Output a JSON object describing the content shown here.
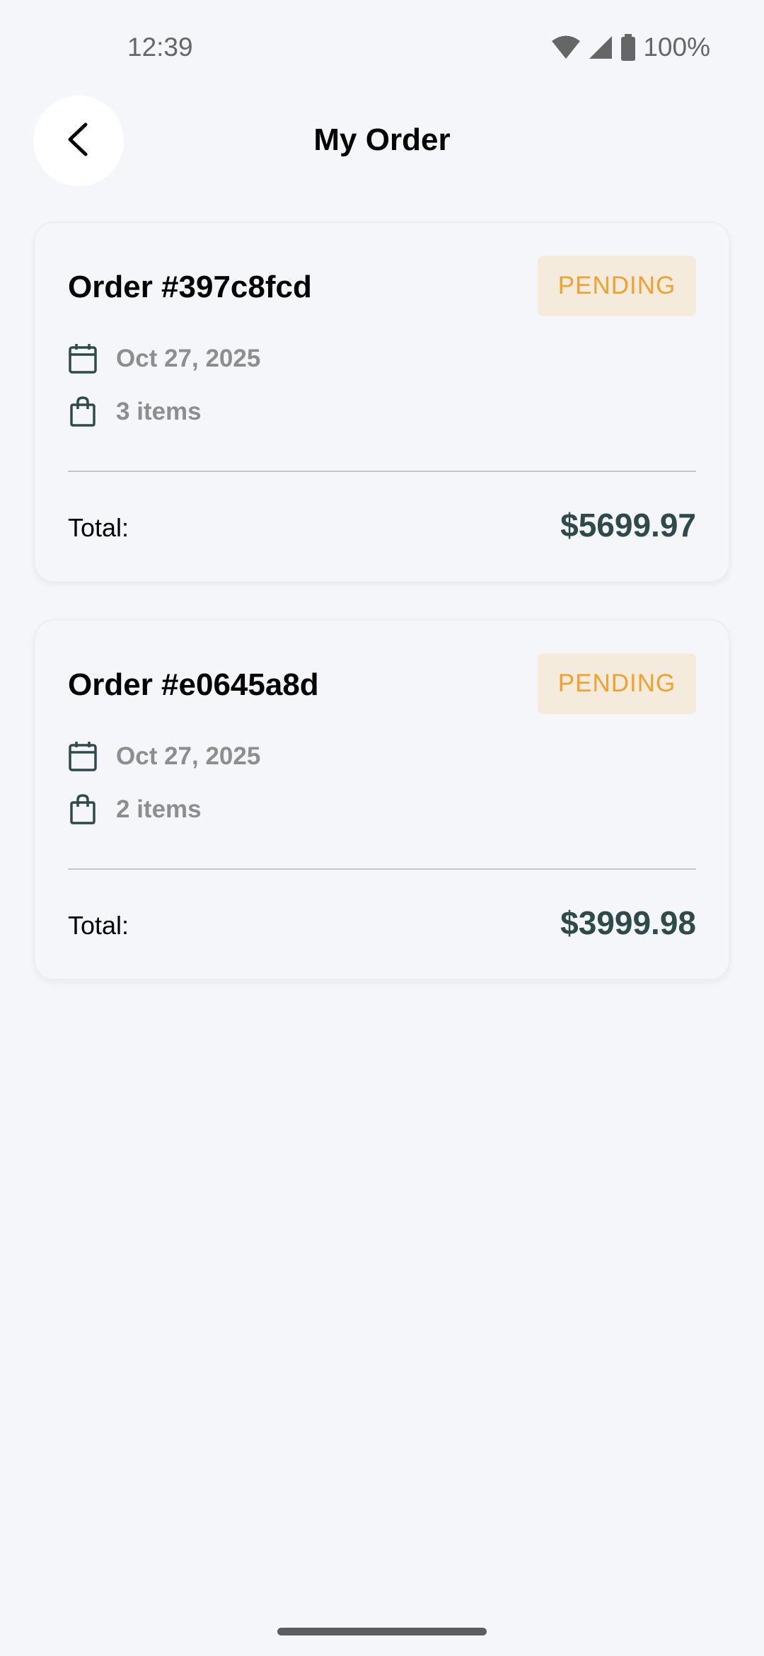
{
  "status_bar": {
    "time": "12:39",
    "battery": "100%"
  },
  "header": {
    "title": "My Order"
  },
  "orders": [
    {
      "title": "Order #397c8fcd",
      "status": "PENDING",
      "date": "Oct 27, 2025",
      "items": "3 items",
      "total_label": "Total:",
      "total": "$5699.97"
    },
    {
      "title": "Order #e0645a8d",
      "status": "PENDING",
      "date": "Oct 27, 2025",
      "items": "2 items",
      "total_label": "Total:",
      "total": "$3999.98"
    }
  ],
  "colors": {
    "background": "#f4f6fa",
    "status_pending_bg": "#f5ebdd",
    "status_pending_text": "#f0a12e",
    "total_text": "#2e4a4a",
    "icon": "#2e4a4a"
  },
  "icons": {
    "back": "chevron-left-icon",
    "date": "calendar-icon",
    "items": "shopping-bag-icon",
    "wifi": "wifi-icon",
    "signal": "signal-icon",
    "battery": "battery-icon"
  }
}
